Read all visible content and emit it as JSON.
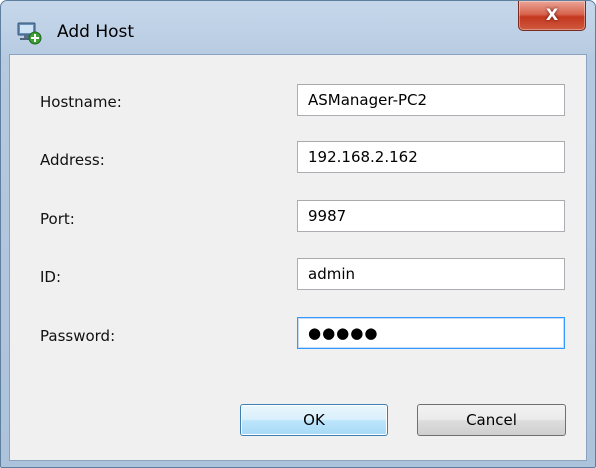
{
  "window": {
    "title": "Add Host",
    "close_glyph": "X",
    "icon": "add-host-icon"
  },
  "form": {
    "hostname": {
      "label": "Hostname:",
      "value": "ASManager-PC2"
    },
    "address": {
      "label": "Address:",
      "value": "192.168.2.162"
    },
    "port": {
      "label": "Port:",
      "value": "9987"
    },
    "id": {
      "label": "ID:",
      "value": "admin"
    },
    "password": {
      "label": "Password:",
      "value": "●●●●●"
    }
  },
  "buttons": {
    "ok": "OK",
    "cancel": "Cancel"
  },
  "colors": {
    "frame": "#b9cde3",
    "close_button": "#c4371f",
    "focus_border": "#3399ff",
    "default_button": "#3c7fb1"
  }
}
